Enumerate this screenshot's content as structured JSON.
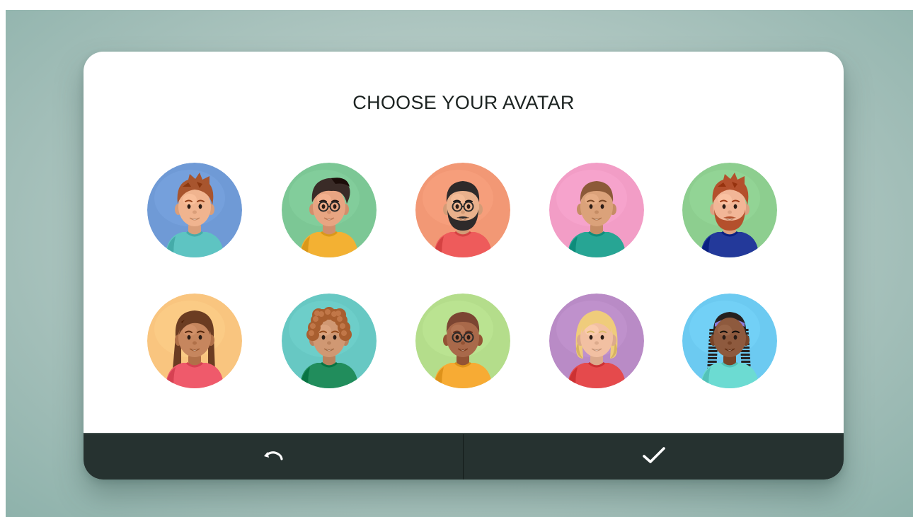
{
  "dialog": {
    "title": "CHOOSE YOUR AVATAR"
  },
  "avatars": [
    {
      "bg": "#6f9ad6",
      "skin": "#f0b48f",
      "hair": "#a8552e",
      "shirt": "#5ec4c2",
      "hair_style": "spiky",
      "glasses": false,
      "beard": false
    },
    {
      "bg": "#7cc795",
      "skin": "#e8a582",
      "hair": "#3a2b27",
      "shirt": "#f3b133",
      "hair_style": "quiff",
      "glasses": true,
      "beard": false
    },
    {
      "bg": "#f29875",
      "skin": "#e9b18c",
      "hair": "#2e2a2a",
      "shirt": "#ee5b5b",
      "hair_style": "short",
      "glasses": true,
      "beard": true
    },
    {
      "bg": "#f29dc6",
      "skin": "#dba27a",
      "hair": "#8c5a38",
      "shirt": "#27a594",
      "hair_style": "short",
      "glasses": false,
      "beard": false
    },
    {
      "bg": "#8dce8f",
      "skin": "#f2b697",
      "hair": "#b4502c",
      "shirt": "#23399a",
      "hair_style": "spiky",
      "glasses": false,
      "beard": true
    },
    {
      "bg": "#f9c57f",
      "skin": "#c6865e",
      "hair": "#6b3c22",
      "shirt": "#ef5a6b",
      "hair_style": "long",
      "glasses": false,
      "beard": false
    },
    {
      "bg": "#67c8c3",
      "skin": "#d09873",
      "hair": "#a85e2f",
      "shirt": "#218d5c",
      "hair_style": "curly",
      "glasses": false,
      "beard": false
    },
    {
      "bg": "#b4dd8b",
      "skin": "#a9694a",
      "hair": "#7b4532",
      "shirt": "#f7ab34",
      "hair_style": "short",
      "glasses": true,
      "beard": false
    },
    {
      "bg": "#b98bc6",
      "skin": "#f2c0a2",
      "hair": "#efcc7b",
      "shirt": "#e54a4c",
      "hair_style": "bob",
      "glasses": false,
      "beard": false
    },
    {
      "bg": "#6ccaf1",
      "skin": "#8e5a3e",
      "hair": "#25211f",
      "shirt": "#6cdbd2",
      "hair_style": "braids",
      "glasses": false,
      "beard": false
    }
  ],
  "footer": {
    "back_icon": "undo-arrow-icon",
    "confirm_icon": "checkmark-icon"
  }
}
